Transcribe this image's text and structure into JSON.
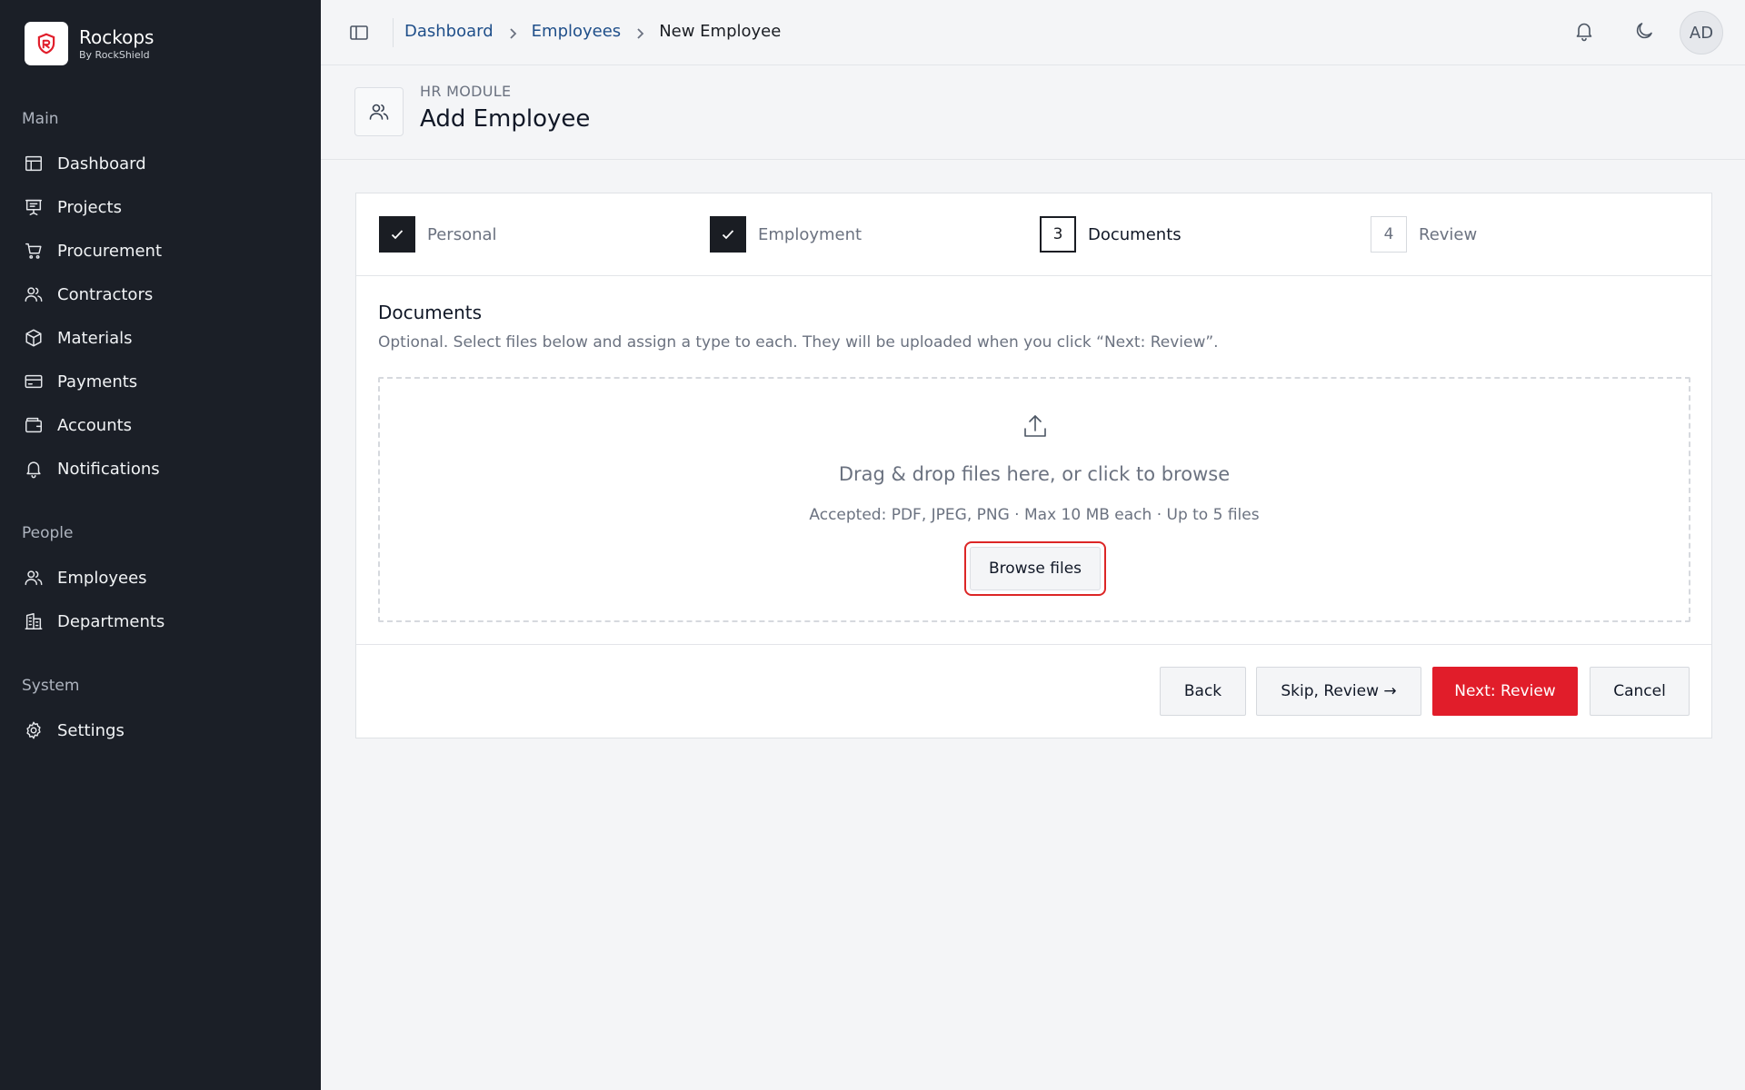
{
  "brand": {
    "name": "Rockops",
    "subtitle": "By RockShield",
    "accent": "#e11d2a"
  },
  "sidebar": {
    "sections": [
      {
        "title": "Main",
        "items": [
          {
            "label": "Dashboard",
            "icon": "layout-icon"
          },
          {
            "label": "Projects",
            "icon": "presentation-icon"
          },
          {
            "label": "Procurement",
            "icon": "cart-icon"
          },
          {
            "label": "Contractors",
            "icon": "users-icon"
          },
          {
            "label": "Materials",
            "icon": "box-icon"
          },
          {
            "label": "Payments",
            "icon": "credit-card-icon"
          },
          {
            "label": "Accounts",
            "icon": "wallet-icon"
          },
          {
            "label": "Notifications",
            "icon": "bell-icon"
          }
        ]
      },
      {
        "title": "People",
        "items": [
          {
            "label": "Employees",
            "icon": "users-icon"
          },
          {
            "label": "Departments",
            "icon": "building-icon"
          }
        ]
      },
      {
        "title": "System",
        "items": [
          {
            "label": "Settings",
            "icon": "gear-icon"
          }
        ]
      }
    ]
  },
  "breadcrumb": {
    "items": [
      "Dashboard",
      "Employees"
    ],
    "current": "New Employee"
  },
  "user": {
    "initials": "AD"
  },
  "header": {
    "kicker": "HR MODULE",
    "title": "Add Employee"
  },
  "steps": [
    {
      "label": "Personal",
      "status": "done"
    },
    {
      "label": "Employment",
      "status": "done"
    },
    {
      "number": "3",
      "label": "Documents",
      "status": "active"
    },
    {
      "number": "4",
      "label": "Review",
      "status": "pending"
    }
  ],
  "documents": {
    "title": "Documents",
    "description": "Optional. Select files below and assign a type to each. They will be uploaded when you click “Next: Review”.",
    "dropzone": {
      "main": "Drag & drop files here, or click to browse",
      "sub": "Accepted: PDF, JPEG, PNG · Max 10 MB each · Up to 5 files",
      "button": "Browse files"
    }
  },
  "footer": {
    "back": "Back",
    "skip": "Skip, Review →",
    "next": "Next: Review",
    "cancel": "Cancel"
  }
}
